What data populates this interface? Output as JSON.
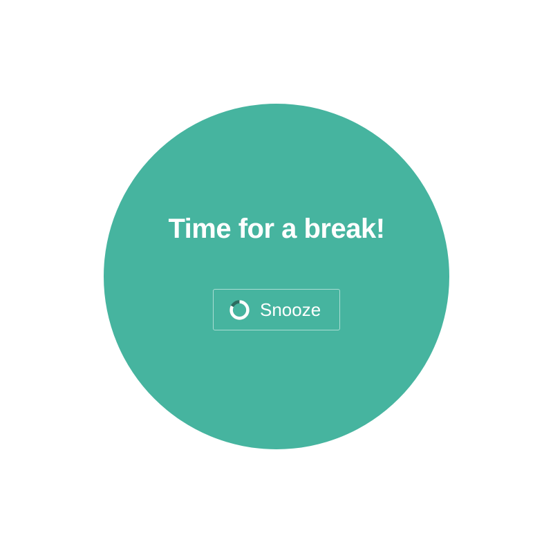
{
  "colors": {
    "page_background": "#ffffff",
    "circle_fill": "#46b49f",
    "text": "#ffffff",
    "ring_track": "#2d6b60"
  },
  "overlay": {
    "title": "Time for a break!"
  },
  "snooze": {
    "label": "Snooze",
    "icon": "progress-ring-icon",
    "progress_fraction": 0.82
  }
}
